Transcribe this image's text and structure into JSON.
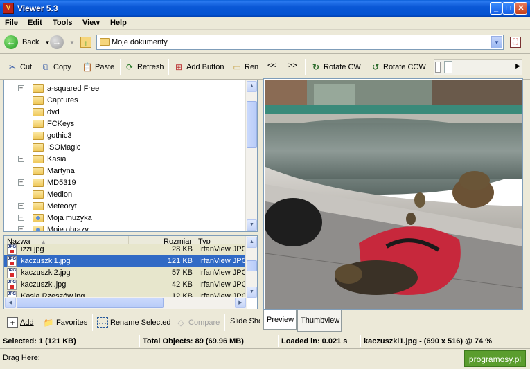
{
  "window": {
    "title": "Viewer 5.3",
    "icon_text": "V"
  },
  "menu": [
    "File",
    "Edit",
    "Tools",
    "View",
    "Help"
  ],
  "nav": {
    "back": "Back",
    "address": "Moje dokumenty"
  },
  "left_toolbar": [
    {
      "label": "Cut",
      "icon": "scissors-icon"
    },
    {
      "label": "Copy",
      "icon": "copy-icon"
    },
    {
      "label": "Paste",
      "icon": "paste-icon"
    },
    {
      "label": "Refresh",
      "icon": "refresh-icon"
    },
    {
      "label": "Add Button",
      "icon": "add-button-icon"
    },
    {
      "label": "Ren",
      "icon": "folder-icon"
    }
  ],
  "right_toolbar": {
    "prev": "<<",
    "next": ">>",
    "rotate_cw": "Rotate CW",
    "rotate_ccw": "Rotate CCW"
  },
  "tree": [
    {
      "label": "a-squared Free",
      "expandable": true
    },
    {
      "label": "Captures",
      "expandable": false
    },
    {
      "label": "dvd",
      "expandable": false
    },
    {
      "label": "FCKeys",
      "expandable": false
    },
    {
      "label": "gothic3",
      "expandable": false
    },
    {
      "label": "ISOMagic",
      "expandable": false
    },
    {
      "label": "Kasia",
      "expandable": true
    },
    {
      "label": "Martyna",
      "expandable": false
    },
    {
      "label": "MD5319",
      "expandable": true
    },
    {
      "label": "Medion",
      "expandable": false
    },
    {
      "label": "Meteoryt",
      "expandable": true
    },
    {
      "label": "Moja muzyka",
      "expandable": true
    },
    {
      "label": "Moje obrazy",
      "expandable": true
    }
  ],
  "file_list": {
    "columns": [
      "Nazwa",
      "Rozmiar",
      "Typ"
    ],
    "rows": [
      {
        "name": "izzi.jpg",
        "size": "28 KB",
        "type": "IrfanView JPG",
        "selected": false
      },
      {
        "name": "kaczuszki1.jpg",
        "size": "121 KB",
        "type": "IrfanView JPG",
        "selected": true
      },
      {
        "name": "kaczuszki2.jpg",
        "size": "57 KB",
        "type": "IrfanView JPG",
        "selected": false
      },
      {
        "name": "kaczuszki.jpg",
        "size": "42 KB",
        "type": "IrfanView JPG",
        "selected": false
      },
      {
        "name": "Kasia Rzeszów.jpg",
        "size": "12 KB",
        "type": "IrfanView JPG",
        "selected": false
      }
    ]
  },
  "bottom_toolbar": [
    {
      "label": "Add",
      "icon": "add-icon"
    },
    {
      "label": "Favorites",
      "icon": "favorites-icon"
    },
    {
      "label": "Rename Selected",
      "icon": "rename-icon"
    },
    {
      "label": "Compare",
      "icon": "compare-icon"
    },
    {
      "label": "Slide Sho",
      "icon": "slideshow-icon"
    }
  ],
  "tabs": {
    "preview": "Preview",
    "thumbview": "Thumbview"
  },
  "status": {
    "selected": "Selected: 1 (121 KB)",
    "total": "Total Objects: 89 (69.96 MB)",
    "loaded": "Loaded in: 0.021 s",
    "info": "kaczuszki1.jpg -  (690 x 516) @ 74  %",
    "drag": "Drag Here:"
  },
  "watermark": "programosy.pl"
}
